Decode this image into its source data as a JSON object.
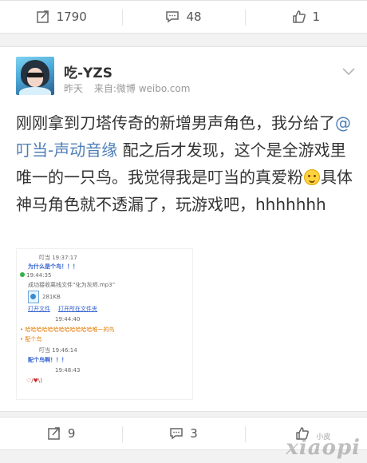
{
  "top_actions": {
    "repost_count": "1790",
    "comment_count": "48",
    "like_count": "1"
  },
  "post": {
    "username": "吃-YZS",
    "time": "昨天",
    "source": "来自:微博 weibo.com",
    "text_before": "刚刚拿到刀塔传奇的新增男声角色，我分给了",
    "mention": "@叮当-声动音缘",
    "text_middle": " 配之后才发现，这个是全游戏里唯一的一只鸟。我觉得我是叮当的真爱粉",
    "text_after": "具体神马角色就不透漏了，玩游戏吧，hhhhhhh"
  },
  "chat_image": {
    "line1": "叮当  19:37:17",
    "line2": "为什么是个鸟！！！",
    "line3": "19:44:35",
    "line4": "成功接收离线文件“化为灰烬.mp3”",
    "file_size": "281KB",
    "file_open": "打开文件",
    "file_folder": "打开所在文件夹",
    "line5": "19:44:40",
    "line6": "哈哈哈哈哈哈哈哈哈哈哈哈唯一的鸟",
    "line7": "配个鸟",
    "line8": "叮当  19:46:14",
    "line9": "配个鸟啊！！！",
    "line10": "19:48:43",
    "line11": "♡/♥\\)"
  },
  "bottom_actions": {
    "repost_count": "9",
    "comment_count": "3",
    "like_count": ""
  },
  "watermark": {
    "text": "xiaopi",
    "small": "小皮"
  },
  "icons": {
    "repost": "repost-icon",
    "comment": "comment-icon",
    "like": "thumbs-up-icon",
    "chevron": "chevron-down-icon"
  },
  "colors": {
    "mention": "#4f7fb6",
    "meta": "#999999",
    "chat_blue": "#2f5fd0",
    "chat_orange": "#e27a00"
  }
}
